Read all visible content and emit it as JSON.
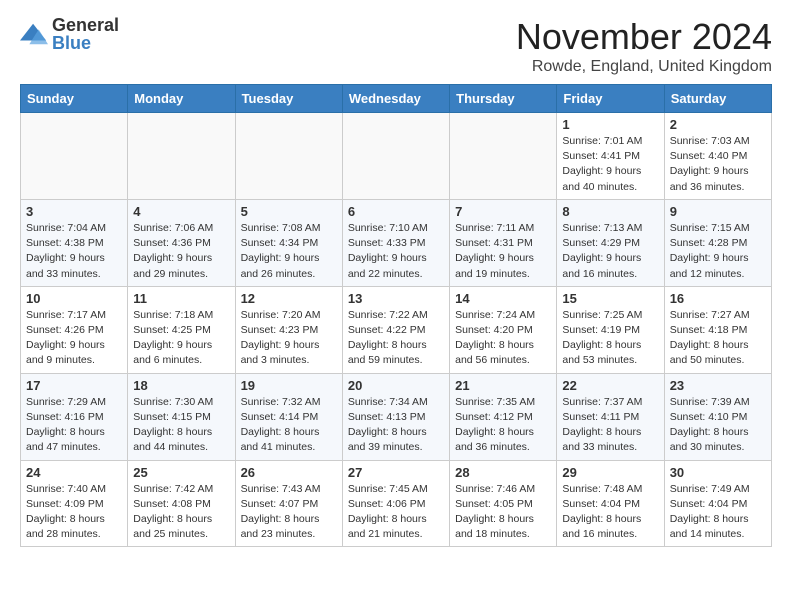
{
  "logo": {
    "general": "General",
    "blue": "Blue"
  },
  "title": "November 2024",
  "location": "Rowde, England, United Kingdom",
  "days_of_week": [
    "Sunday",
    "Monday",
    "Tuesday",
    "Wednesday",
    "Thursday",
    "Friday",
    "Saturday"
  ],
  "weeks": [
    [
      {
        "day": "",
        "info": ""
      },
      {
        "day": "",
        "info": ""
      },
      {
        "day": "",
        "info": ""
      },
      {
        "day": "",
        "info": ""
      },
      {
        "day": "",
        "info": ""
      },
      {
        "day": "1",
        "info": "Sunrise: 7:01 AM\nSunset: 4:41 PM\nDaylight: 9 hours\nand 40 minutes."
      },
      {
        "day": "2",
        "info": "Sunrise: 7:03 AM\nSunset: 4:40 PM\nDaylight: 9 hours\nand 36 minutes."
      }
    ],
    [
      {
        "day": "3",
        "info": "Sunrise: 7:04 AM\nSunset: 4:38 PM\nDaylight: 9 hours\nand 33 minutes."
      },
      {
        "day": "4",
        "info": "Sunrise: 7:06 AM\nSunset: 4:36 PM\nDaylight: 9 hours\nand 29 minutes."
      },
      {
        "day": "5",
        "info": "Sunrise: 7:08 AM\nSunset: 4:34 PM\nDaylight: 9 hours\nand 26 minutes."
      },
      {
        "day": "6",
        "info": "Sunrise: 7:10 AM\nSunset: 4:33 PM\nDaylight: 9 hours\nand 22 minutes."
      },
      {
        "day": "7",
        "info": "Sunrise: 7:11 AM\nSunset: 4:31 PM\nDaylight: 9 hours\nand 19 minutes."
      },
      {
        "day": "8",
        "info": "Sunrise: 7:13 AM\nSunset: 4:29 PM\nDaylight: 9 hours\nand 16 minutes."
      },
      {
        "day": "9",
        "info": "Sunrise: 7:15 AM\nSunset: 4:28 PM\nDaylight: 9 hours\nand 12 minutes."
      }
    ],
    [
      {
        "day": "10",
        "info": "Sunrise: 7:17 AM\nSunset: 4:26 PM\nDaylight: 9 hours\nand 9 minutes."
      },
      {
        "day": "11",
        "info": "Sunrise: 7:18 AM\nSunset: 4:25 PM\nDaylight: 9 hours\nand 6 minutes."
      },
      {
        "day": "12",
        "info": "Sunrise: 7:20 AM\nSunset: 4:23 PM\nDaylight: 9 hours\nand 3 minutes."
      },
      {
        "day": "13",
        "info": "Sunrise: 7:22 AM\nSunset: 4:22 PM\nDaylight: 8 hours\nand 59 minutes."
      },
      {
        "day": "14",
        "info": "Sunrise: 7:24 AM\nSunset: 4:20 PM\nDaylight: 8 hours\nand 56 minutes."
      },
      {
        "day": "15",
        "info": "Sunrise: 7:25 AM\nSunset: 4:19 PM\nDaylight: 8 hours\nand 53 minutes."
      },
      {
        "day": "16",
        "info": "Sunrise: 7:27 AM\nSunset: 4:18 PM\nDaylight: 8 hours\nand 50 minutes."
      }
    ],
    [
      {
        "day": "17",
        "info": "Sunrise: 7:29 AM\nSunset: 4:16 PM\nDaylight: 8 hours\nand 47 minutes."
      },
      {
        "day": "18",
        "info": "Sunrise: 7:30 AM\nSunset: 4:15 PM\nDaylight: 8 hours\nand 44 minutes."
      },
      {
        "day": "19",
        "info": "Sunrise: 7:32 AM\nSunset: 4:14 PM\nDaylight: 8 hours\nand 41 minutes."
      },
      {
        "day": "20",
        "info": "Sunrise: 7:34 AM\nSunset: 4:13 PM\nDaylight: 8 hours\nand 39 minutes."
      },
      {
        "day": "21",
        "info": "Sunrise: 7:35 AM\nSunset: 4:12 PM\nDaylight: 8 hours\nand 36 minutes."
      },
      {
        "day": "22",
        "info": "Sunrise: 7:37 AM\nSunset: 4:11 PM\nDaylight: 8 hours\nand 33 minutes."
      },
      {
        "day": "23",
        "info": "Sunrise: 7:39 AM\nSunset: 4:10 PM\nDaylight: 8 hours\nand 30 minutes."
      }
    ],
    [
      {
        "day": "24",
        "info": "Sunrise: 7:40 AM\nSunset: 4:09 PM\nDaylight: 8 hours\nand 28 minutes."
      },
      {
        "day": "25",
        "info": "Sunrise: 7:42 AM\nSunset: 4:08 PM\nDaylight: 8 hours\nand 25 minutes."
      },
      {
        "day": "26",
        "info": "Sunrise: 7:43 AM\nSunset: 4:07 PM\nDaylight: 8 hours\nand 23 minutes."
      },
      {
        "day": "27",
        "info": "Sunrise: 7:45 AM\nSunset: 4:06 PM\nDaylight: 8 hours\nand 21 minutes."
      },
      {
        "day": "28",
        "info": "Sunrise: 7:46 AM\nSunset: 4:05 PM\nDaylight: 8 hours\nand 18 minutes."
      },
      {
        "day": "29",
        "info": "Sunrise: 7:48 AM\nSunset: 4:04 PM\nDaylight: 8 hours\nand 16 minutes."
      },
      {
        "day": "30",
        "info": "Sunrise: 7:49 AM\nSunset: 4:04 PM\nDaylight: 8 hours\nand 14 minutes."
      }
    ]
  ]
}
